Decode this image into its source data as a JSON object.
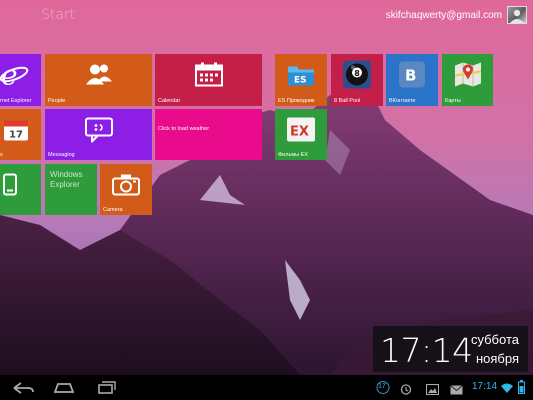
{
  "header": {
    "title": "Start",
    "account_email": "skifchaqwerty@gmail.com"
  },
  "tiles": {
    "internet_explorer": "rnet Explorer",
    "people": "People",
    "calendar": "Calendar",
    "es_explorer": "ES Проводник",
    "eight_ball": "8 Ball Pool",
    "vk": "ВКонтакте",
    "maps": "Карты",
    "store_partial": "s",
    "messaging": "Messaging",
    "weather": "Click to load weather",
    "ex_files": "Фильмы EX",
    "windows_explorer": "Windows Explorer",
    "camera": "Camera"
  },
  "clock": {
    "time": "17:14",
    "day": "суббота",
    "month": "ноября"
  },
  "status_bar": {
    "time": "17:14",
    "notification_count": "17"
  },
  "colors": {
    "purple": "#8c1ee6",
    "orange": "#d25b1a",
    "crimson": "#c41f49",
    "magenta": "#ea0b8d",
    "red": "#cf2a2a",
    "green": "#2e9c3a",
    "blue_tile": "#2b72c9",
    "accent_status": "#33b5e5"
  }
}
